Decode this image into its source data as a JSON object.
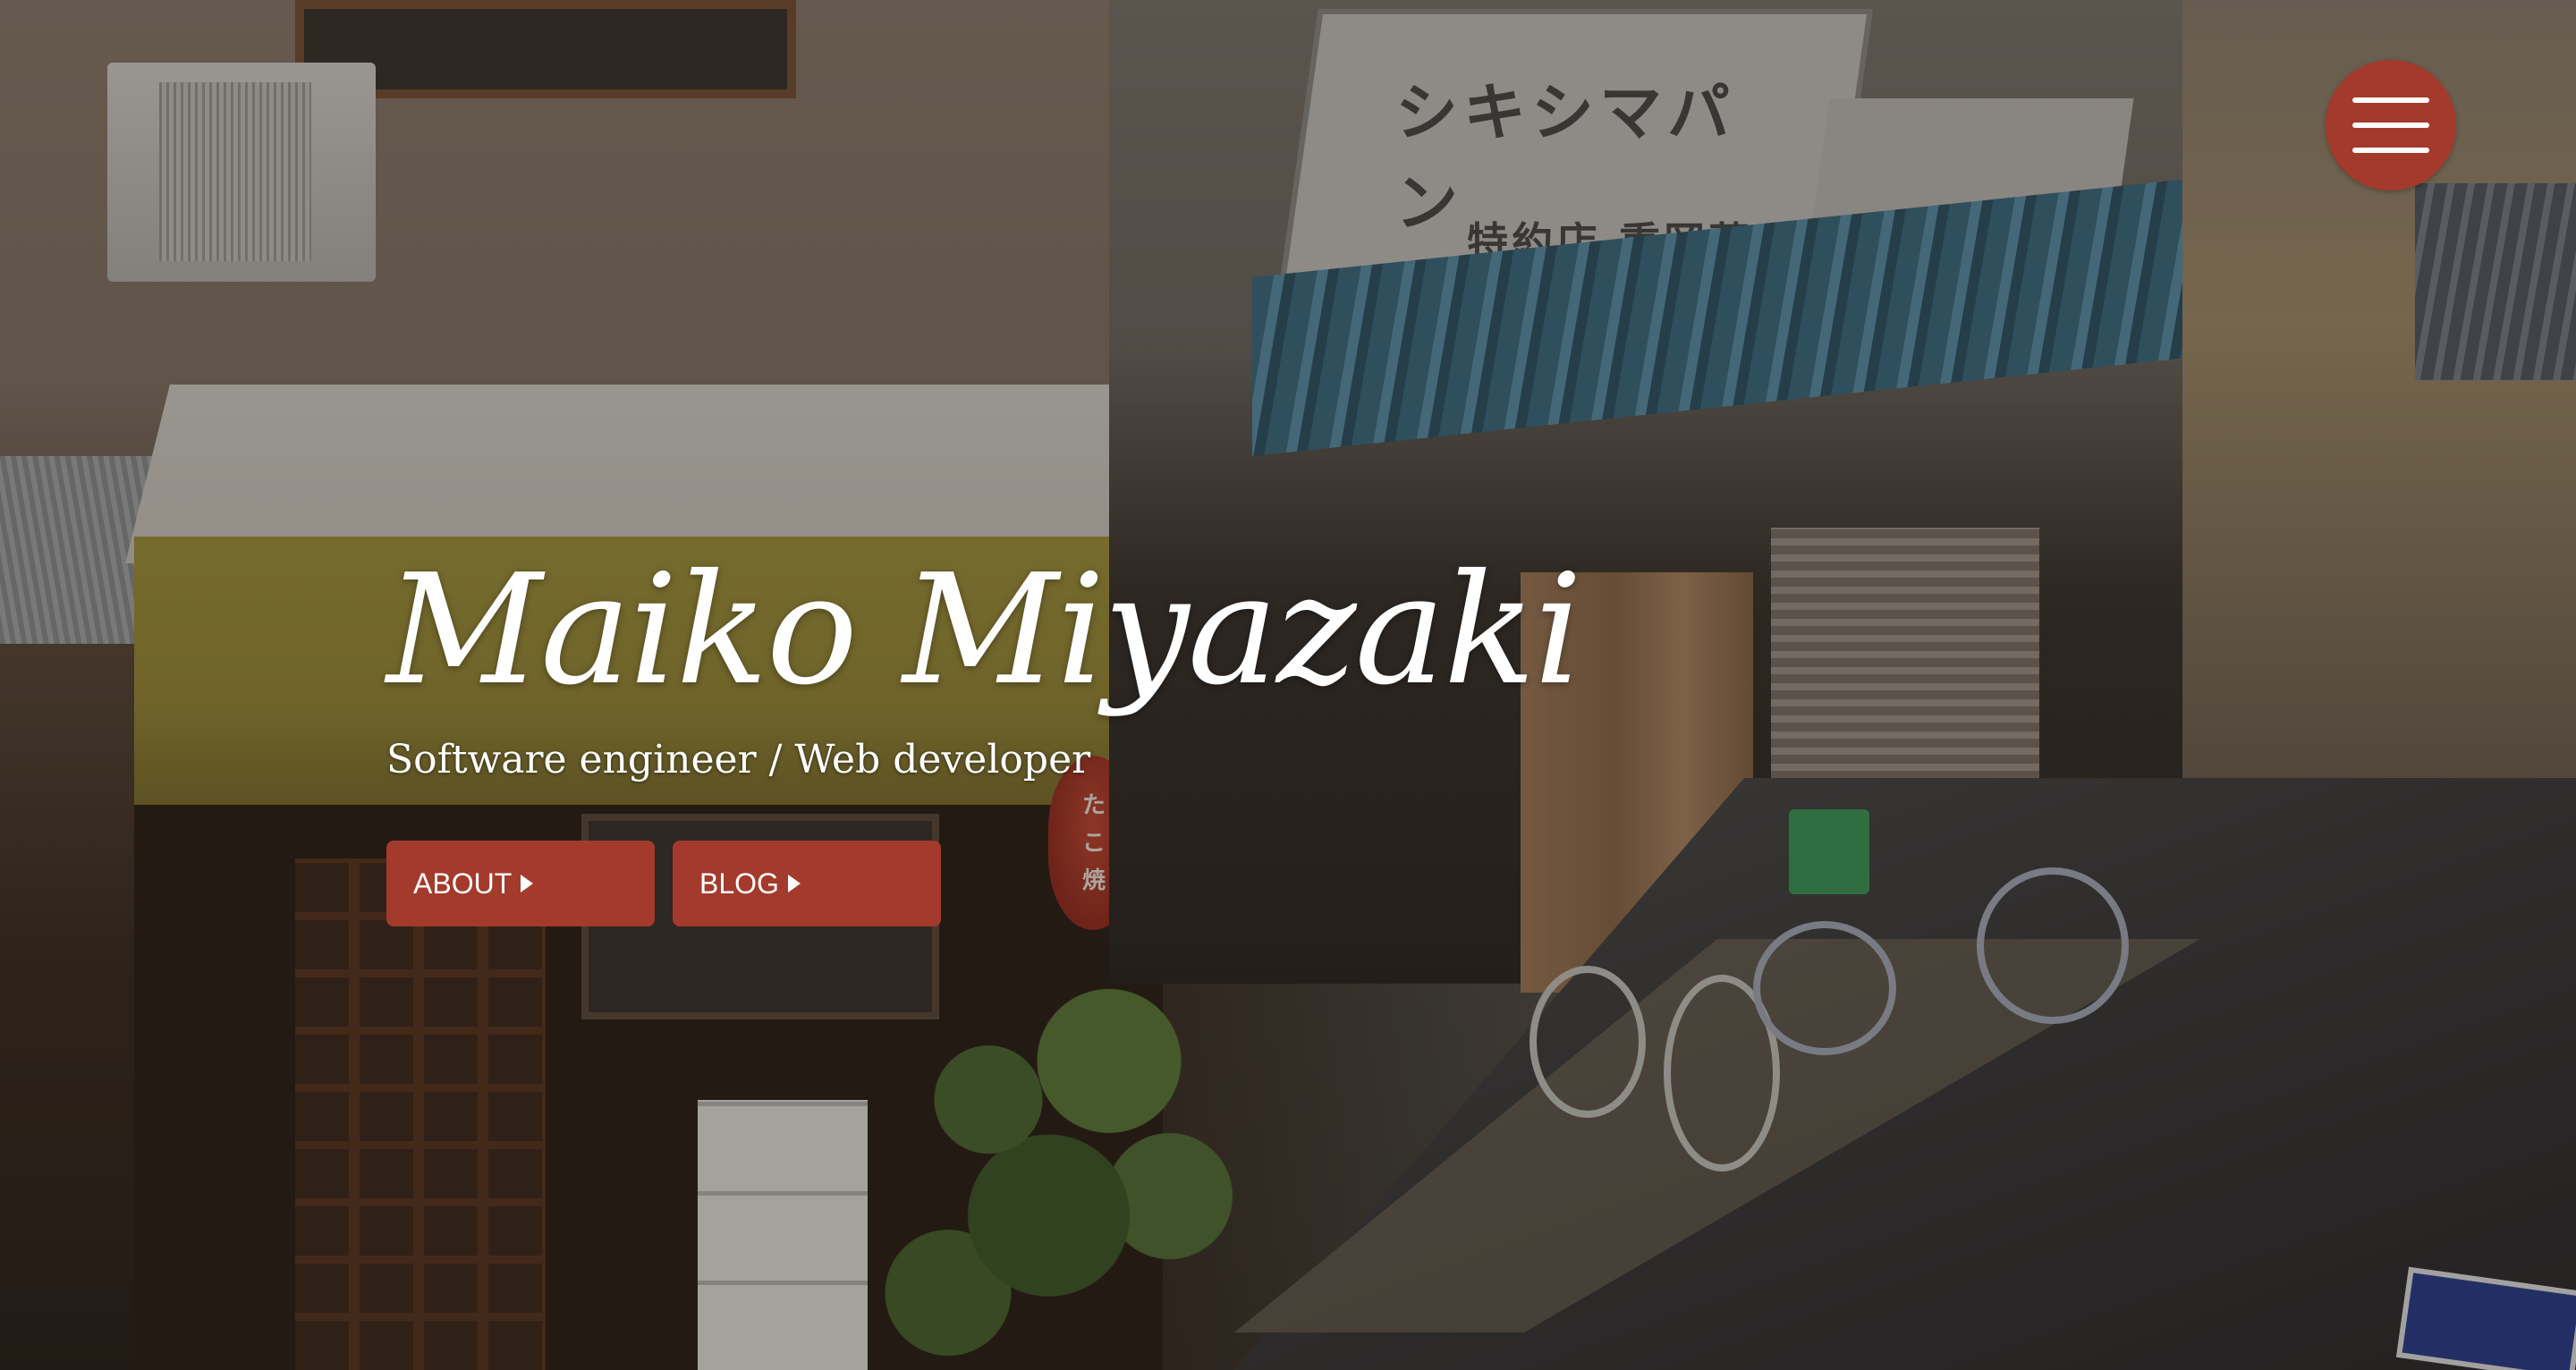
{
  "hero": {
    "name": "Maiko Miyazaki",
    "subtitle": "Software engineer / Web developer"
  },
  "nav": {
    "about_label": "ABOUT",
    "blog_label": "BLOG"
  },
  "menu": {
    "icon": "hamburger-menu-icon"
  },
  "background": {
    "sign_title": "シキシマパン",
    "sign_subtitle": "特約店 重岡菓子店",
    "lantern_text": "たこ焼"
  },
  "colors": {
    "accent": "#a43a2c",
    "text": "#ffffff"
  }
}
